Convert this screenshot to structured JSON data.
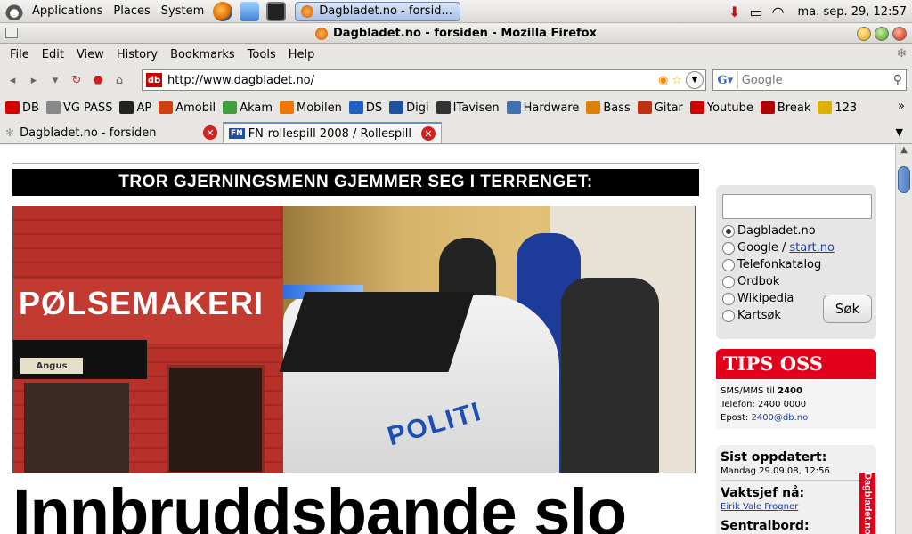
{
  "panel": {
    "menus": [
      "Applications",
      "Places",
      "System"
    ],
    "taskbar_window": "Dagbladet.no - forsid...",
    "clock": "ma. sep. 29, 12:57"
  },
  "window": {
    "title": "Dagbladet.no - forsiden - Mozilla Firefox"
  },
  "menubar": [
    "File",
    "Edit",
    "View",
    "History",
    "Bookmarks",
    "Tools",
    "Help"
  ],
  "navbar": {
    "url": "http://www.dagbladet.no/",
    "search_placeholder": "Google",
    "favicon_text": "db"
  },
  "bookmarks": [
    {
      "label": "DB",
      "color": "#d40000"
    },
    {
      "label": "VG PASS",
      "color": "#888888"
    },
    {
      "label": "AP",
      "color": "#222222"
    },
    {
      "label": "Amobil",
      "color": "#d04010"
    },
    {
      "label": "Akam",
      "color": "#40a040"
    },
    {
      "label": "Mobilen",
      "color": "#f07800"
    },
    {
      "label": "DS",
      "color": "#2060c0"
    },
    {
      "label": "Digi",
      "color": "#2050a0"
    },
    {
      "label": "ITavisen",
      "color": "#333333"
    },
    {
      "label": "Hardware",
      "color": "#4070b0"
    },
    {
      "label": "Bass",
      "color": "#e08000"
    },
    {
      "label": "Gitar",
      "color": "#c03010"
    },
    {
      "label": "Youtube",
      "color": "#cc0000"
    },
    {
      "label": "Break",
      "color": "#b00000"
    },
    {
      "label": "123",
      "color": "#e0b000"
    }
  ],
  "tabs": [
    {
      "label": "Dagbladet.no - forsiden"
    },
    {
      "label": "FN-rollespill 2008 / Rollespill ..."
    }
  ],
  "page": {
    "headline_bar": "TROR GJERNINGSMENN GJEMMER SEG I TERRENGET:",
    "photo_sign": "PØLSEMAKERI",
    "photo_awning": "Angus",
    "photo_car": "POLITI",
    "big_headline": "Innbruddsbande slo"
  },
  "sidebar": {
    "search_options": [
      {
        "label": "Dagbladet.no",
        "selected": true
      },
      {
        "label": "Google /",
        "link": "start.no",
        "selected": false
      },
      {
        "label": "Telefonkatalog",
        "selected": false
      },
      {
        "label": "Ordbok",
        "selected": false
      },
      {
        "label": "Wikipedia",
        "selected": false
      },
      {
        "label": "Kartsøk",
        "selected": false
      }
    ],
    "search_button": "Søk",
    "tips": {
      "title": "TIPS OSS",
      "sms_prefix": "SMS/MMS til ",
      "sms_number": "2400",
      "phone": "Telefon: 2400 0000",
      "email_prefix": "Epost: ",
      "email": "2400@db.no"
    },
    "updated": {
      "title": "Sist oppdatert:",
      "date": "Mandag 29.09.08, 12:56",
      "vaktsjef_label": "Vaktsjef nå:",
      "vaktsjef_name": "Eirik Vale Frogner",
      "sentralbord_label": "Sentralbord:"
    },
    "vertical_brand": "Dagbladet.no"
  }
}
